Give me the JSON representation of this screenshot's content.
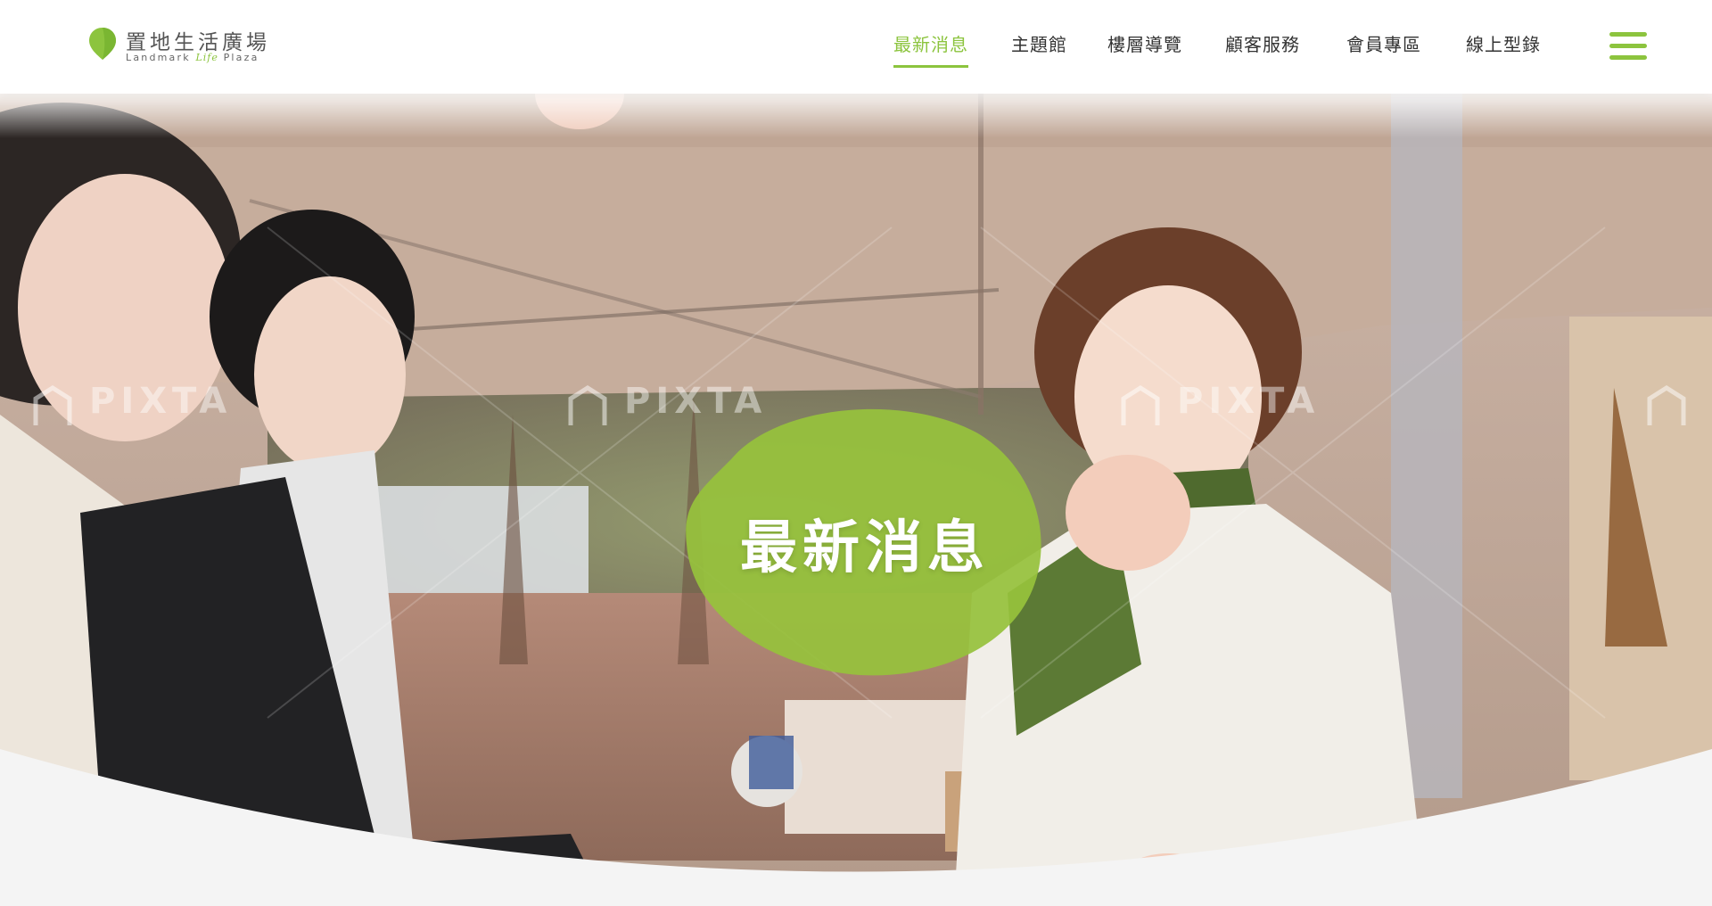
{
  "brand": {
    "name": "置地生活廣場",
    "subtitle_pre": "Landmark ",
    "subtitle_script": "Life",
    "subtitle_post": " Plaza",
    "accent_color": "#8cc43e"
  },
  "nav": {
    "items": [
      {
        "label": "最新消息",
        "active": true
      },
      {
        "label": "主題館",
        "active": false
      },
      {
        "label": "樓層導覽",
        "active": false
      },
      {
        "label": "顧客服務",
        "active": false
      },
      {
        "label": "會員專區",
        "active": false
      },
      {
        "label": "線上型錄",
        "active": false
      }
    ],
    "menu_icon": "hamburger-icon"
  },
  "hero": {
    "title": "最新消息",
    "watermark": "PIXTA"
  }
}
